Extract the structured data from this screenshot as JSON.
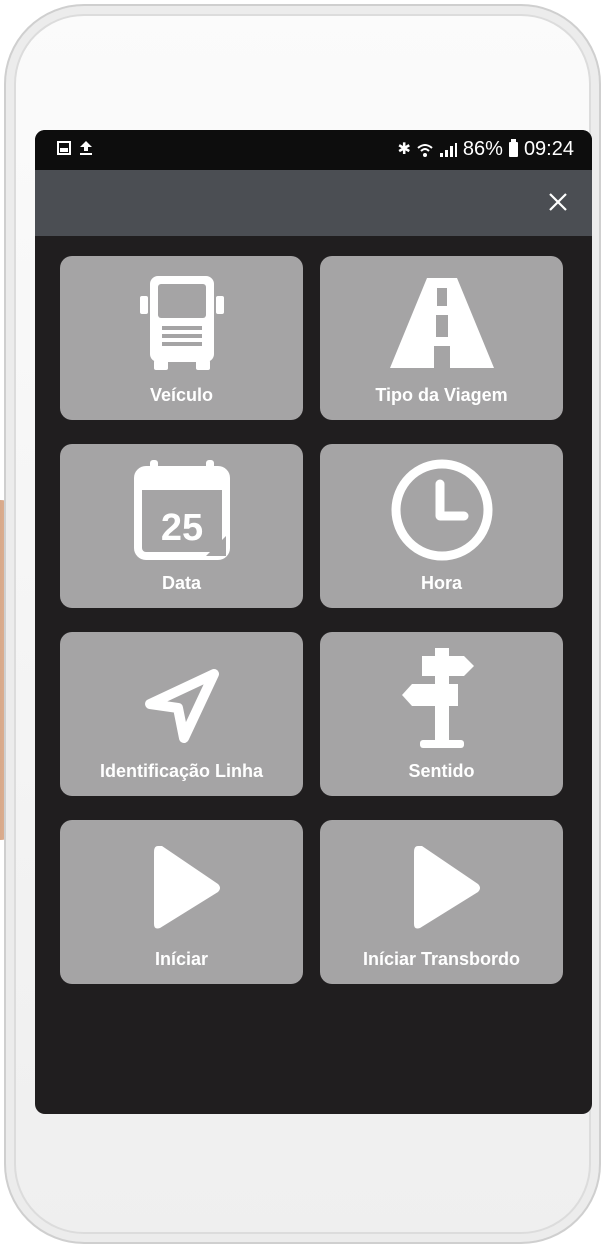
{
  "statusbar": {
    "left_icons": [
      "image-icon",
      "upload-icon"
    ],
    "battery_percent": "86%",
    "time": "09:24",
    "right_icons": [
      "bluetooth-icon",
      "wifi-icon",
      "signal-icon",
      "battery-icon"
    ]
  },
  "appbar": {
    "close_icon": "close-icon"
  },
  "tiles": [
    {
      "label": "Veículo",
      "icon": "truck-icon"
    },
    {
      "label": "Tipo da Viagem",
      "icon": "road-icon"
    },
    {
      "label": "Data",
      "icon": "calendar-icon",
      "icon_text": "25"
    },
    {
      "label": "Hora",
      "icon": "clock-icon"
    },
    {
      "label": "Identificação Linha",
      "icon": "navigation-arrow-icon"
    },
    {
      "label": "Sentido",
      "icon": "signpost-icon"
    },
    {
      "label": "Iníciar",
      "icon": "play-icon"
    },
    {
      "label": "Iníciar Transbordo",
      "icon": "play-icon"
    }
  ],
  "colors": {
    "screen_bg": "#201e1f",
    "appbar_bg": "#4b4e53",
    "tile_bg": "#a5a4a5",
    "icon_fg": "#ffffff"
  }
}
